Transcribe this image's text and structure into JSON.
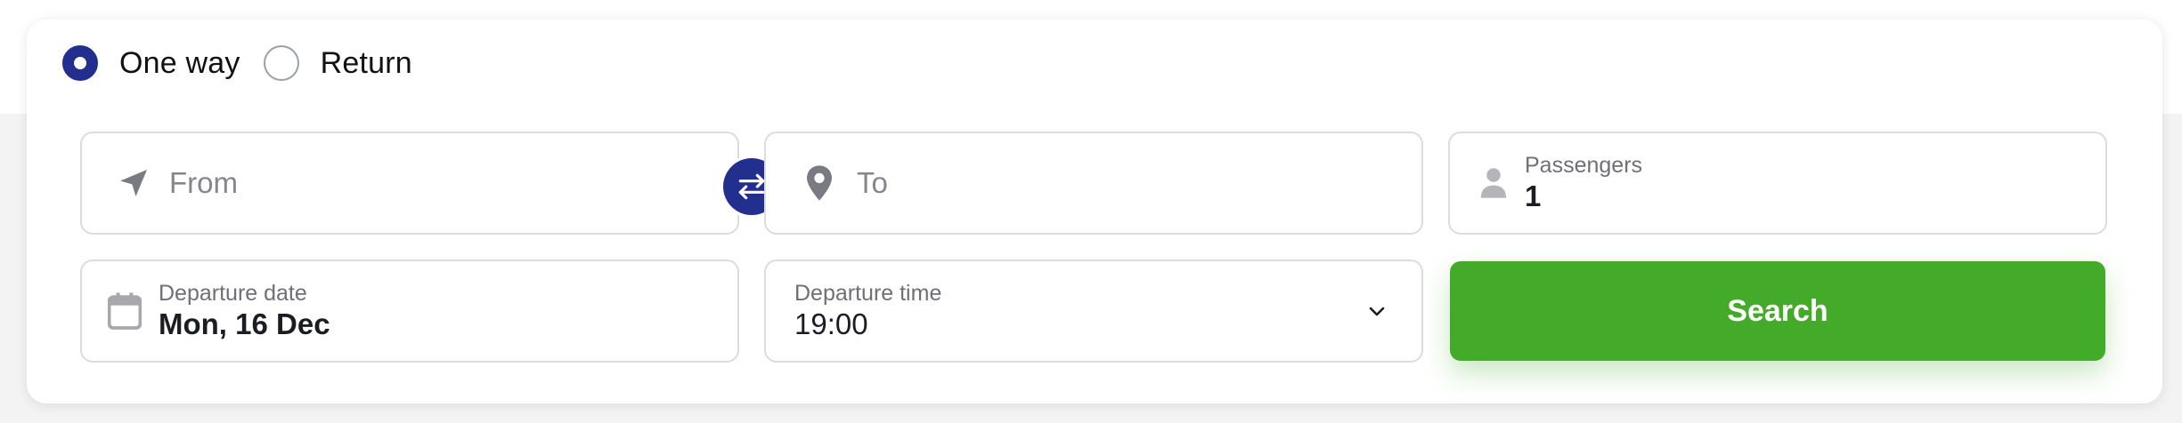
{
  "trip_type": {
    "options": [
      {
        "label": "One way",
        "selected": true
      },
      {
        "label": "Return",
        "selected": false
      }
    ]
  },
  "from": {
    "placeholder": "From",
    "icon": "navigation-arrow-icon"
  },
  "swap": {
    "icon": "swap-arrows-icon"
  },
  "to": {
    "placeholder": "To",
    "icon": "map-pin-icon"
  },
  "passengers": {
    "label": "Passengers",
    "value": "1",
    "icon": "person-icon"
  },
  "departure_date": {
    "label": "Departure date",
    "value": "Mon, 16 Dec",
    "icon": "calendar-icon"
  },
  "departure_time": {
    "label": "Departure time",
    "value": "19:00",
    "icon": "chevron-down-icon"
  },
  "search": {
    "label": "Search"
  },
  "colors": {
    "primary": "#232f8e",
    "accent_green": "#44aa2a",
    "border": "#dcdcde",
    "muted_text": "#85858d"
  }
}
